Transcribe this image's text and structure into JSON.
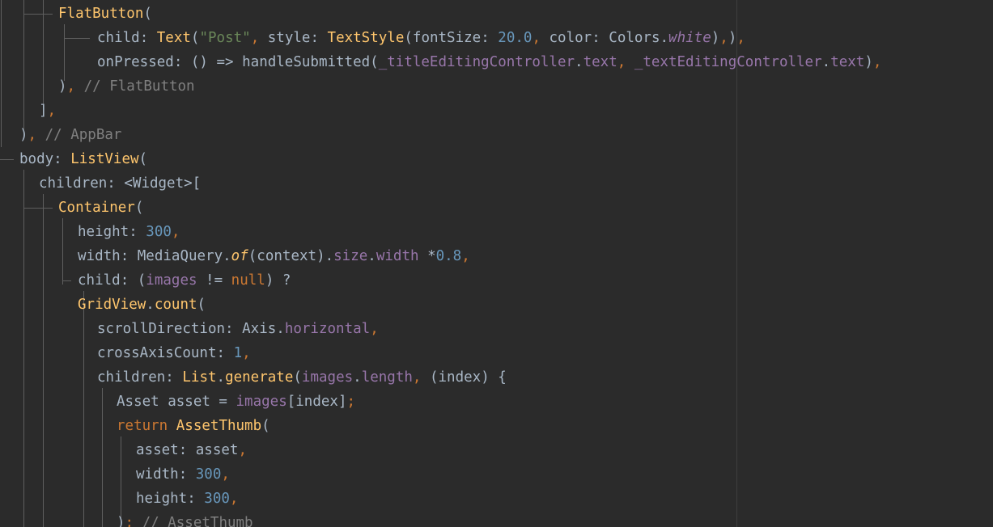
{
  "editor": {
    "lines": [
      [
        {
          "t": "FlatButton",
          "c": "cls"
        },
        {
          "t": "(",
          "c": "punc"
        }
      ],
      [
        {
          "t": "child",
          "c": "id"
        },
        {
          "t": ": ",
          "c": "punc"
        },
        {
          "t": "Text",
          "c": "cls"
        },
        {
          "t": "(",
          "c": "punc"
        },
        {
          "t": "\"Post\"",
          "c": "str"
        },
        {
          "t": ", ",
          "c": "comma"
        },
        {
          "t": "style",
          "c": "id"
        },
        {
          "t": ": ",
          "c": "punc"
        },
        {
          "t": "TextStyle",
          "c": "cls"
        },
        {
          "t": "(",
          "c": "punc"
        },
        {
          "t": "fontSize",
          "c": "id"
        },
        {
          "t": ": ",
          "c": "punc"
        },
        {
          "t": "20.0",
          "c": "num"
        },
        {
          "t": ", ",
          "c": "comma"
        },
        {
          "t": "color",
          "c": "id"
        },
        {
          "t": ": ",
          "c": "punc"
        },
        {
          "t": "Colors",
          "c": "id"
        },
        {
          "t": ".",
          "c": "punc"
        },
        {
          "t": "white",
          "c": "italic"
        },
        {
          "t": ")",
          "c": "punc"
        },
        {
          "t": ",",
          "c": "comma"
        },
        {
          "t": ")",
          "c": "punc"
        },
        {
          "t": ",",
          "c": "comma"
        }
      ],
      [
        {
          "t": "onPressed",
          "c": "id"
        },
        {
          "t": ": () => ",
          "c": "punc"
        },
        {
          "t": "handleSubmitted",
          "c": "id"
        },
        {
          "t": "(",
          "c": "punc"
        },
        {
          "t": "_titleEditingController",
          "c": "field"
        },
        {
          "t": ".",
          "c": "punc"
        },
        {
          "t": "text",
          "c": "field"
        },
        {
          "t": ", ",
          "c": "comma"
        },
        {
          "t": "_textEditingController",
          "c": "field"
        },
        {
          "t": ".",
          "c": "punc"
        },
        {
          "t": "text",
          "c": "field"
        },
        {
          "t": ")",
          "c": "punc"
        },
        {
          "t": ",",
          "c": "comma"
        }
      ],
      [
        {
          "t": ")",
          "c": "punc"
        },
        {
          "t": ", ",
          "c": "comma"
        },
        {
          "t": "// FlatButton",
          "c": "comment"
        }
      ],
      [
        {
          "t": "]",
          "c": "punc"
        },
        {
          "t": ",",
          "c": "comma"
        }
      ],
      [
        {
          "t": ")",
          "c": "punc"
        },
        {
          "t": ", ",
          "c": "comma"
        },
        {
          "t": "// AppBar",
          "c": "comment"
        }
      ],
      [
        {
          "t": "body",
          "c": "id"
        },
        {
          "t": ": ",
          "c": "punc"
        },
        {
          "t": "ListView",
          "c": "cls"
        },
        {
          "t": "(",
          "c": "punc"
        }
      ],
      [
        {
          "t": "children",
          "c": "id"
        },
        {
          "t": ": <",
          "c": "punc"
        },
        {
          "t": "Widget",
          "c": "id"
        },
        {
          "t": ">[",
          "c": "punc"
        }
      ],
      [
        {
          "t": "Container",
          "c": "cls"
        },
        {
          "t": "(",
          "c": "punc"
        }
      ],
      [
        {
          "t": "height",
          "c": "id"
        },
        {
          "t": ": ",
          "c": "punc"
        },
        {
          "t": "300",
          "c": "num"
        },
        {
          "t": ",",
          "c": "comma"
        }
      ],
      [
        {
          "t": "width",
          "c": "id"
        },
        {
          "t": ": ",
          "c": "punc"
        },
        {
          "t": "MediaQuery",
          "c": "id"
        },
        {
          "t": ".",
          "c": "punc"
        },
        {
          "t": "of",
          "c": "fn-italic"
        },
        {
          "t": "(",
          "c": "punc"
        },
        {
          "t": "context",
          "c": "id"
        },
        {
          "t": ").",
          "c": "punc"
        },
        {
          "t": "size",
          "c": "field"
        },
        {
          "t": ".",
          "c": "punc"
        },
        {
          "t": "width",
          "c": "field"
        },
        {
          "t": " *",
          "c": "punc"
        },
        {
          "t": "0.8",
          "c": "num"
        },
        {
          "t": ",",
          "c": "comma"
        }
      ],
      [
        {
          "t": "child",
          "c": "id"
        },
        {
          "t": ": (",
          "c": "punc"
        },
        {
          "t": "images",
          "c": "field"
        },
        {
          "t": " != ",
          "c": "punc"
        },
        {
          "t": "null",
          "c": "kw"
        },
        {
          "t": ") ?",
          "c": "punc"
        }
      ],
      [
        {
          "t": "GridView",
          "c": "cls"
        },
        {
          "t": ".",
          "c": "punc"
        },
        {
          "t": "count",
          "c": "cls"
        },
        {
          "t": "(",
          "c": "punc"
        }
      ],
      [
        {
          "t": "scrollDirection",
          "c": "id"
        },
        {
          "t": ": ",
          "c": "punc"
        },
        {
          "t": "Axis",
          "c": "id"
        },
        {
          "t": ".",
          "c": "punc"
        },
        {
          "t": "horizontal",
          "c": "field"
        },
        {
          "t": ",",
          "c": "comma"
        }
      ],
      [
        {
          "t": "crossAxisCount",
          "c": "id"
        },
        {
          "t": ": ",
          "c": "punc"
        },
        {
          "t": "1",
          "c": "num"
        },
        {
          "t": ",",
          "c": "comma"
        }
      ],
      [
        {
          "t": "children",
          "c": "id"
        },
        {
          "t": ": ",
          "c": "punc"
        },
        {
          "t": "List",
          "c": "cls"
        },
        {
          "t": ".",
          "c": "punc"
        },
        {
          "t": "generate",
          "c": "cls"
        },
        {
          "t": "(",
          "c": "punc"
        },
        {
          "t": "images",
          "c": "field"
        },
        {
          "t": ".",
          "c": "punc"
        },
        {
          "t": "length",
          "c": "field"
        },
        {
          "t": ", ",
          "c": "comma"
        },
        {
          "t": "(index) {",
          "c": "punc"
        }
      ],
      [
        {
          "t": "Asset asset = ",
          "c": "id"
        },
        {
          "t": "images",
          "c": "field"
        },
        {
          "t": "[index]",
          "c": "punc"
        },
        {
          "t": ";",
          "c": "comma"
        }
      ],
      [
        {
          "t": "return ",
          "c": "kw"
        },
        {
          "t": "AssetThumb",
          "c": "cls"
        },
        {
          "t": "(",
          "c": "punc"
        }
      ],
      [
        {
          "t": "asset",
          "c": "id"
        },
        {
          "t": ": ",
          "c": "punc"
        },
        {
          "t": "asset",
          "c": "id"
        },
        {
          "t": ",",
          "c": "comma"
        }
      ],
      [
        {
          "t": "width",
          "c": "id"
        },
        {
          "t": ": ",
          "c": "punc"
        },
        {
          "t": "300",
          "c": "num"
        },
        {
          "t": ",",
          "c": "comma"
        }
      ],
      [
        {
          "t": "height",
          "c": "id"
        },
        {
          "t": ": ",
          "c": "punc"
        },
        {
          "t": "300",
          "c": "num"
        },
        {
          "t": ",",
          "c": "comma"
        }
      ],
      [
        {
          "t": ")",
          "c": "punc"
        },
        {
          "t": "; ",
          "c": "comma"
        },
        {
          "t": "// AssetThumb",
          "c": "comment"
        }
      ]
    ]
  }
}
